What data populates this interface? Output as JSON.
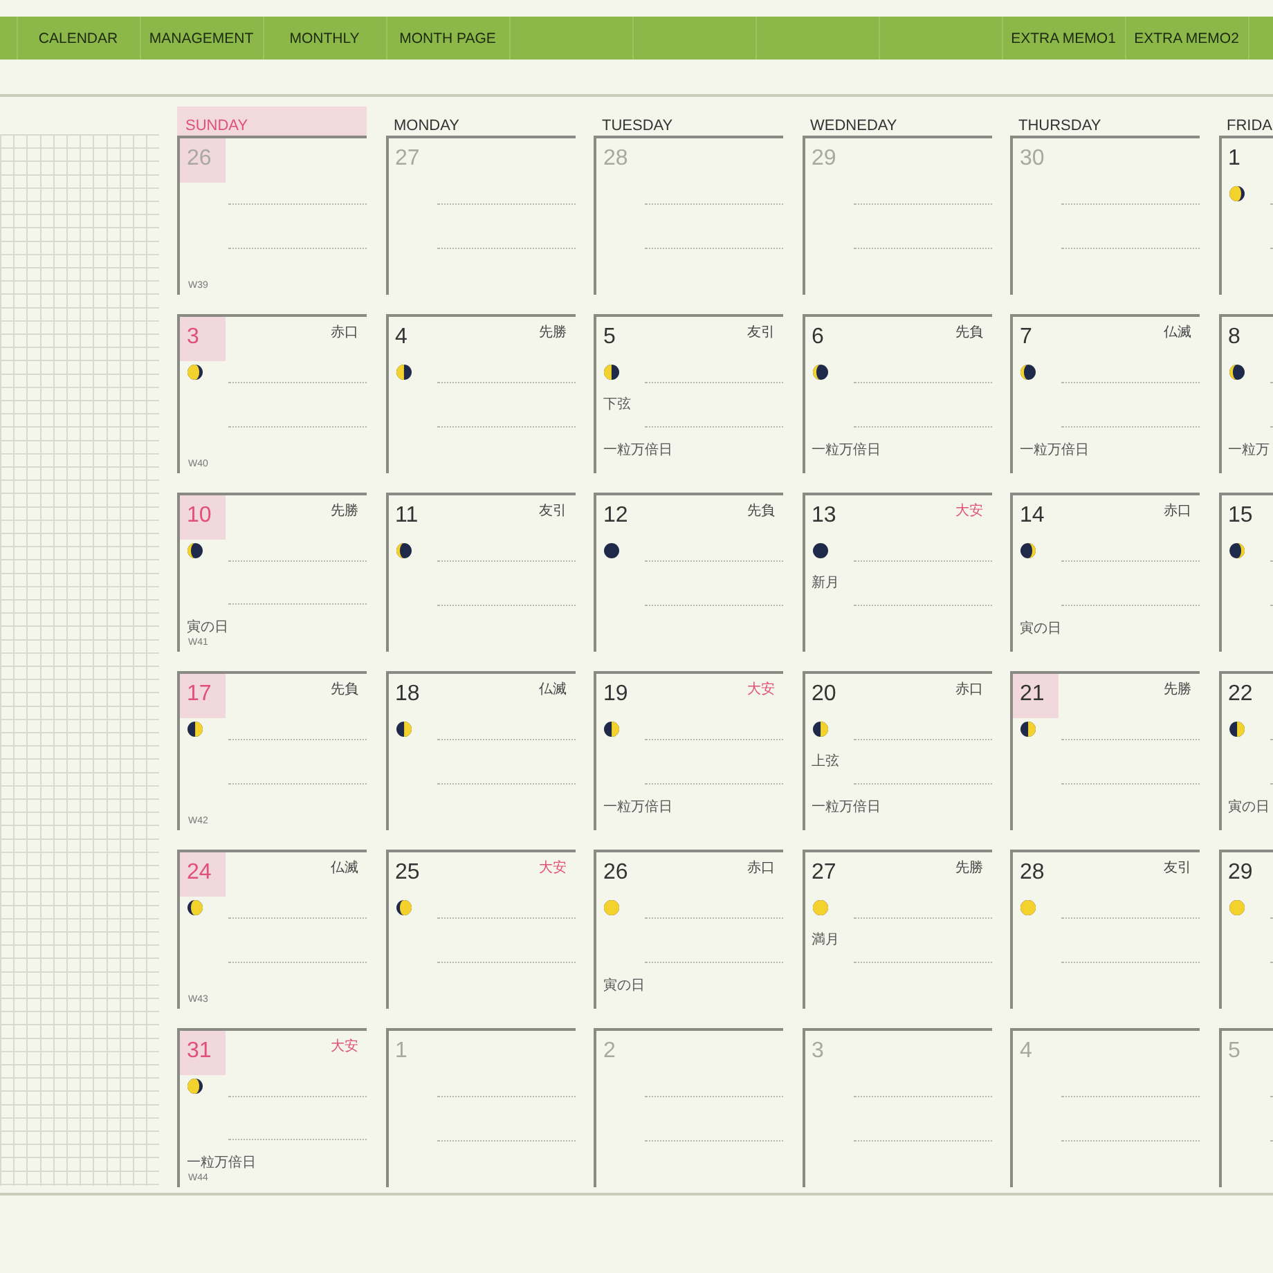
{
  "nav": {
    "left_tabs": [
      {
        "label": "CALENDAR"
      },
      {
        "label": "MANAGEMENT"
      },
      {
        "label": "MONTHLY"
      },
      {
        "label": "MONTH PAGE"
      }
    ],
    "right_tabs": [
      {
        "label": "EXTRA MEMO1"
      },
      {
        "label": "EXTRA MEMO2"
      }
    ]
  },
  "calendar": {
    "weekdays": [
      {
        "label": "SUNDAY"
      },
      {
        "label": "MONDAY"
      },
      {
        "label": "TUESDAY"
      },
      {
        "label": "WEDNEDAY"
      },
      {
        "label": "THURSDAY"
      },
      {
        "label": "FRIDA"
      }
    ],
    "weeks": [
      {
        "week": "W39",
        "days": [
          {
            "date": "26",
            "muted": true,
            "highlight": true
          },
          {
            "date": "27",
            "muted": true,
            "highlight": false
          },
          {
            "date": "28",
            "muted": true,
            "highlight": false
          },
          {
            "date": "29",
            "muted": true,
            "highlight": false
          },
          {
            "date": "30",
            "muted": true,
            "highlight": false
          },
          {
            "date": "1",
            "muted": false,
            "highlight": false,
            "moon": {
              "kind": "waning-gibbous"
            }
          }
        ]
      },
      {
        "week": "W40",
        "days": [
          {
            "date": "3",
            "muted": false,
            "highlight": true,
            "rokuyo": {
              "text": "赤口",
              "color": "#444444"
            },
            "moon": {
              "kind": "waning-gibbous"
            }
          },
          {
            "date": "4",
            "muted": false,
            "highlight": false,
            "rokuyo": {
              "text": "先勝",
              "color": "#444444"
            },
            "moon": {
              "kind": "last-quarter"
            }
          },
          {
            "date": "5",
            "muted": false,
            "highlight": false,
            "rokuyo": {
              "text": "友引",
              "color": "#444444"
            },
            "moon": {
              "kind": "last-quarter"
            },
            "moon_label": "下弦",
            "note": "一粒万倍日"
          },
          {
            "date": "6",
            "muted": false,
            "highlight": false,
            "rokuyo": {
              "text": "先負",
              "color": "#444444"
            },
            "moon": {
              "kind": "waning-crescent"
            },
            "note": "一粒万倍日"
          },
          {
            "date": "7",
            "muted": false,
            "highlight": false,
            "rokuyo": {
              "text": "仏滅",
              "color": "#444444"
            },
            "moon": {
              "kind": "waning-crescent"
            },
            "note": "一粒万倍日"
          },
          {
            "date": "8",
            "muted": false,
            "highlight": false,
            "moon": {
              "kind": "waning-crescent"
            },
            "note": "一粒万"
          }
        ]
      },
      {
        "week": "W41",
        "days": [
          {
            "date": "10",
            "muted": false,
            "highlight": true,
            "rokuyo": {
              "text": "先勝",
              "color": "#444444"
            },
            "moon": {
              "kind": "waning-crescent"
            },
            "note": "寅の日"
          },
          {
            "date": "11",
            "muted": false,
            "highlight": false,
            "rokuyo": {
              "text": "友引",
              "color": "#444444"
            },
            "moon": {
              "kind": "waning-crescent"
            }
          },
          {
            "date": "12",
            "muted": false,
            "highlight": false,
            "rokuyo": {
              "text": "先負",
              "color": "#444444"
            },
            "moon": {
              "kind": "new"
            }
          },
          {
            "date": "13",
            "muted": false,
            "highlight": false,
            "rokuyo": {
              "text": "大安",
              "color": "#e0507a"
            },
            "moon": {
              "kind": "new"
            },
            "moon_label": "新月"
          },
          {
            "date": "14",
            "muted": false,
            "highlight": false,
            "rokuyo": {
              "text": "赤口",
              "color": "#444444"
            },
            "moon": {
              "kind": "waxing-crescent"
            },
            "note": "寅の日"
          },
          {
            "date": "15",
            "muted": false,
            "highlight": false,
            "moon": {
              "kind": "waxing-crescent"
            }
          }
        ]
      },
      {
        "week": "W42",
        "days": [
          {
            "date": "17",
            "muted": false,
            "highlight": true,
            "rokuyo": {
              "text": "先負",
              "color": "#444444"
            },
            "moon": {
              "kind": "first-quarter"
            }
          },
          {
            "date": "18",
            "muted": false,
            "highlight": false,
            "rokuyo": {
              "text": "仏滅",
              "color": "#444444"
            },
            "moon": {
              "kind": "first-quarter"
            }
          },
          {
            "date": "19",
            "muted": false,
            "highlight": false,
            "rokuyo": {
              "text": "大安",
              "color": "#e0507a"
            },
            "moon": {
              "kind": "first-quarter"
            },
            "note": "一粒万倍日"
          },
          {
            "date": "20",
            "muted": false,
            "highlight": false,
            "rokuyo": {
              "text": "赤口",
              "color": "#444444"
            },
            "moon": {
              "kind": "first-quarter"
            },
            "moon_label": "上弦",
            "note": "一粒万倍日"
          },
          {
            "date": "21",
            "muted": false,
            "highlight": true,
            "rokuyo": {
              "text": "先勝",
              "color": "#444444"
            },
            "moon": {
              "kind": "first-quarter"
            }
          },
          {
            "date": "22",
            "muted": false,
            "highlight": false,
            "moon": {
              "kind": "first-quarter"
            },
            "note": "寅の日"
          }
        ]
      },
      {
        "week": "W43",
        "days": [
          {
            "date": "24",
            "muted": false,
            "highlight": true,
            "rokuyo": {
              "text": "仏滅",
              "color": "#444444"
            },
            "moon": {
              "kind": "waxing-gibbous"
            }
          },
          {
            "date": "25",
            "muted": false,
            "highlight": false,
            "rokuyo": {
              "text": "大安",
              "color": "#e0507a"
            },
            "moon": {
              "kind": "waxing-gibbous"
            }
          },
          {
            "date": "26",
            "muted": false,
            "highlight": false,
            "rokuyo": {
              "text": "赤口",
              "color": "#444444"
            },
            "moon": {
              "kind": "full"
            },
            "note": "寅の日"
          },
          {
            "date": "27",
            "muted": false,
            "highlight": false,
            "rokuyo": {
              "text": "先勝",
              "color": "#444444"
            },
            "moon": {
              "kind": "full"
            },
            "moon_label": "満月"
          },
          {
            "date": "28",
            "muted": false,
            "highlight": false,
            "rokuyo": {
              "text": "友引",
              "color": "#444444"
            },
            "moon": {
              "kind": "full"
            }
          },
          {
            "date": "29",
            "muted": false,
            "highlight": false,
            "moon": {
              "kind": "full"
            }
          }
        ]
      },
      {
        "week": "W44",
        "days": [
          {
            "date": "31",
            "muted": false,
            "highlight": true,
            "rokuyo": {
              "text": "大安",
              "color": "#e0507a"
            },
            "moon": {
              "kind": "waning-gibbous"
            },
            "note": "一粒万倍日"
          },
          {
            "date": "1",
            "muted": true,
            "highlight": false
          },
          {
            "date": "2",
            "muted": true,
            "highlight": false
          },
          {
            "date": "3",
            "muted": true,
            "highlight": false
          },
          {
            "date": "4",
            "muted": true,
            "highlight": false
          },
          {
            "date": "5",
            "muted": true,
            "highlight": false
          }
        ]
      }
    ]
  }
}
